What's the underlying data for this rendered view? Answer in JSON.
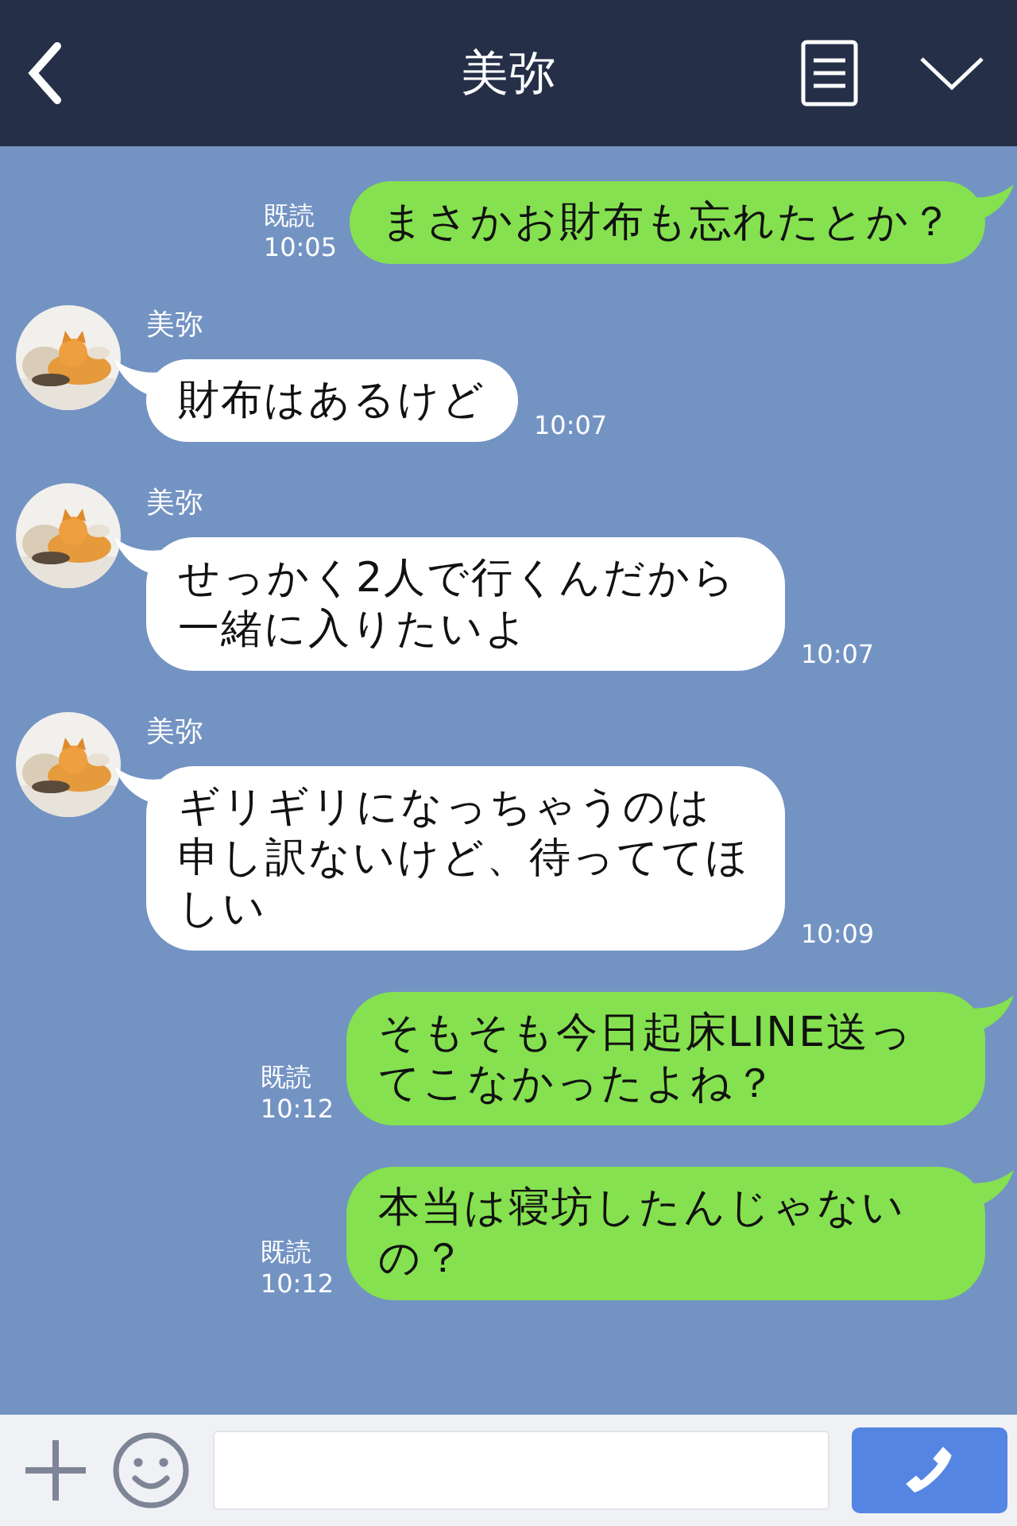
{
  "header": {
    "title": "美弥"
  },
  "messages": [
    {
      "kind": "sent",
      "text": "まさかお財布も忘れたとか？",
      "read": "既読",
      "time": "10:05"
    },
    {
      "kind": "received",
      "sender": "美弥",
      "text": "財布はあるけど",
      "time": "10:07"
    },
    {
      "kind": "received",
      "sender": "美弥",
      "text": "せっかく2人で行くんだから一緒に入りたいよ",
      "time": "10:07"
    },
    {
      "kind": "received",
      "sender": "美弥",
      "text": "ギリギリになっちゃうのは申し訳ないけど、待っててほしい",
      "time": "10:09"
    },
    {
      "kind": "sent",
      "text": "そもそも今日起床LINE送ってこなかったよね？",
      "read": "既読",
      "time": "10:12"
    },
    {
      "kind": "sent",
      "text": "本当は寝坊したんじゃないの？",
      "read": "既読",
      "time": "10:12"
    }
  ]
}
